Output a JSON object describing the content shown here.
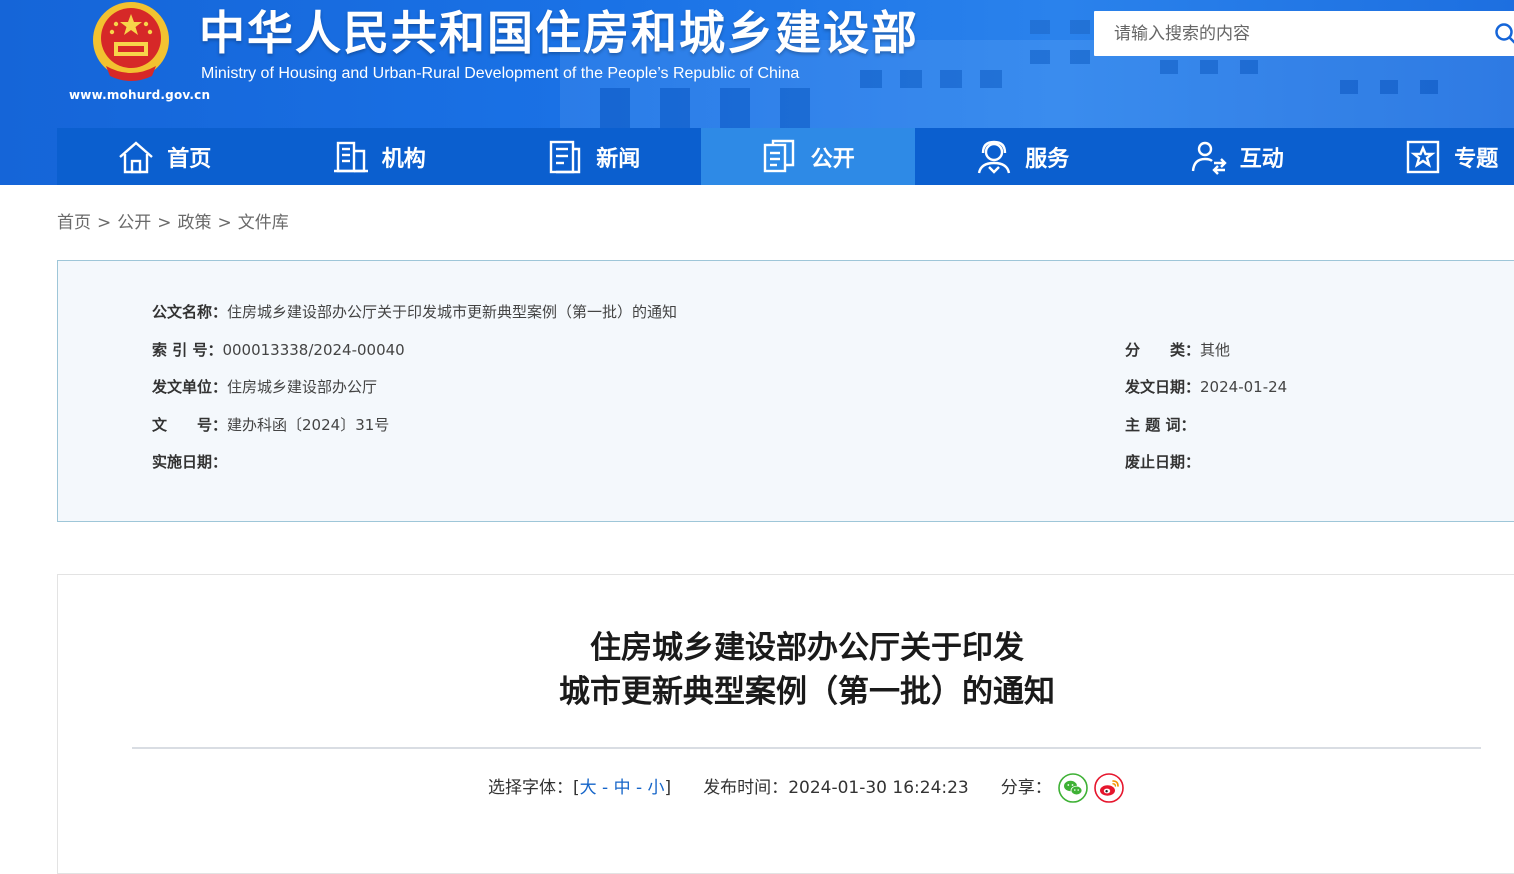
{
  "header": {
    "title_cn": "中华人民共和国住房和城乡建设部",
    "title_en": "Ministry of Housing and Urban-Rural Development of the People’s Republic of China",
    "site_url": "www.mohurd.gov.cn",
    "search_placeholder": "请输入搜索的内容",
    "colors": {
      "header_blue": "#1a72e6",
      "nav_blue": "#0b5fcf",
      "nav_active": "#2e8ae6"
    }
  },
  "nav": {
    "items": [
      {
        "label": "首页",
        "icon": "home-icon"
      },
      {
        "label": "机构",
        "icon": "building-icon"
      },
      {
        "label": "新闻",
        "icon": "newspaper-icon"
      },
      {
        "label": "公开",
        "icon": "document-icon",
        "active": true
      },
      {
        "label": "服务",
        "icon": "service-icon"
      },
      {
        "label": "互动",
        "icon": "interaction-icon"
      },
      {
        "label": "专题",
        "icon": "star-icon"
      }
    ]
  },
  "breadcrumb": {
    "items": [
      "首页",
      "公开",
      "政策",
      "文件库"
    ],
    "separator": ">"
  },
  "meta": {
    "name_label": "公文名称：",
    "name_value": "住房城乡建设部办公厅关于印发城市更新典型案例（第一批）的通知",
    "index_label": "索 引 号：",
    "index_value": "000013338/2024-00040",
    "category_label": "分　　类：",
    "category_value": "其他",
    "issuer_label": "发文单位：",
    "issuer_value": "住房城乡建设部办公厅",
    "issue_date_label": "发文日期：",
    "issue_date_value": "2024-01-24",
    "doc_no_label": "文　　号：",
    "doc_no_value": "建办科函〔2024〕31号",
    "subject_label": "主 题 词：",
    "subject_value": "",
    "effective_label": "实施日期：",
    "effective_value": "",
    "expiry_label": "废止日期：",
    "expiry_value": ""
  },
  "article": {
    "title_line1": "住房城乡建设部办公厅关于印发",
    "title_line2": "城市更新典型案例（第一批）的通知",
    "font_select_label": "选择字体：[",
    "font_large": "大",
    "font_medium": "中",
    "font_small": "小",
    "font_select_close": "]",
    "publish_label": "发布时间：",
    "publish_time": "2024-01-30 16:24:23",
    "share_label": "分享："
  }
}
